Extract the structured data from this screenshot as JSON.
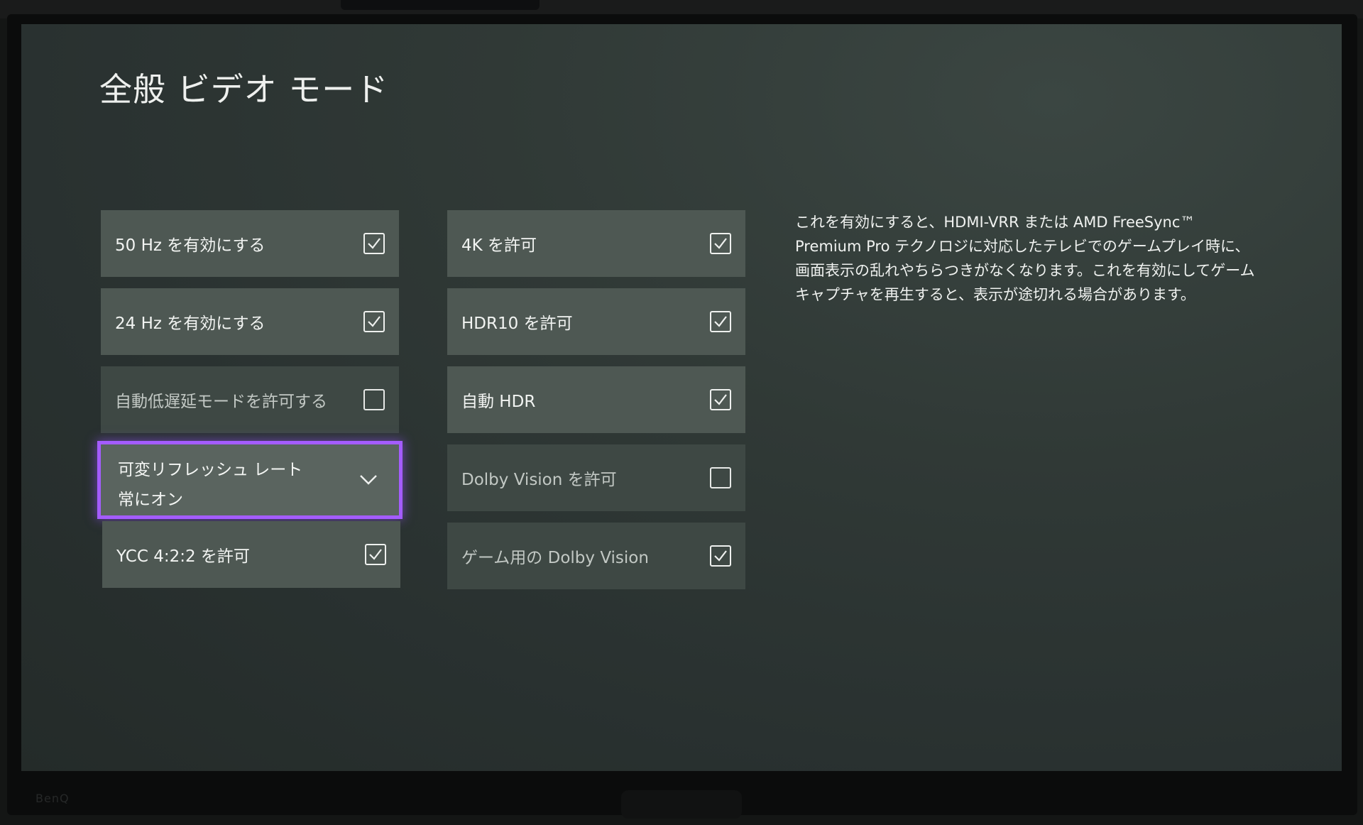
{
  "page": {
    "title": "全般 ビデオ モード"
  },
  "left_column": {
    "items": [
      {
        "label": "50 Hz を有効にする",
        "checked": true,
        "enabled": true
      },
      {
        "label": "24 Hz を有効にする",
        "checked": true,
        "enabled": true
      },
      {
        "label": "自動低遅延モードを許可する",
        "checked": false,
        "enabled": false
      },
      {
        "label": "可変リフレッシュ レート",
        "value": "常にオン",
        "type": "dropdown",
        "focused": true
      },
      {
        "label": "YCC 4:2:2 を許可",
        "checked": true,
        "enabled": true
      }
    ]
  },
  "right_column": {
    "items": [
      {
        "label": "4K を許可",
        "checked": true,
        "enabled": true
      },
      {
        "label": "HDR10 を許可",
        "checked": true,
        "enabled": true
      },
      {
        "label": "自動 HDR",
        "checked": true,
        "enabled": true
      },
      {
        "label": "Dolby Vision を許可",
        "checked": false,
        "enabled": false
      },
      {
        "label": "ゲーム用の Dolby Vision",
        "checked": true,
        "enabled": false
      }
    ]
  },
  "description": {
    "lines": [
      "これを有効にすると、HDMI-VRR または AMD FreeSync™",
      "Premium Pro テクノロジに対応したテレビでのゲームプレイ時に、",
      "画面表示の乱れやちらつきがなくなります。これを有効にしてゲーム",
      "キャプチャを再生すると、表示が途切れる場合があります。"
    ]
  },
  "bezel": {
    "brand": "BenQ"
  },
  "colors": {
    "focus_outline": "#a45cff",
    "tile_bg": "#4e5853",
    "tile_disabled_bg": "#3e4844",
    "screen_bg": "#2d3532"
  },
  "icons": {
    "checkbox_checked": "check-icon",
    "dropdown": "chevron-down-icon"
  }
}
